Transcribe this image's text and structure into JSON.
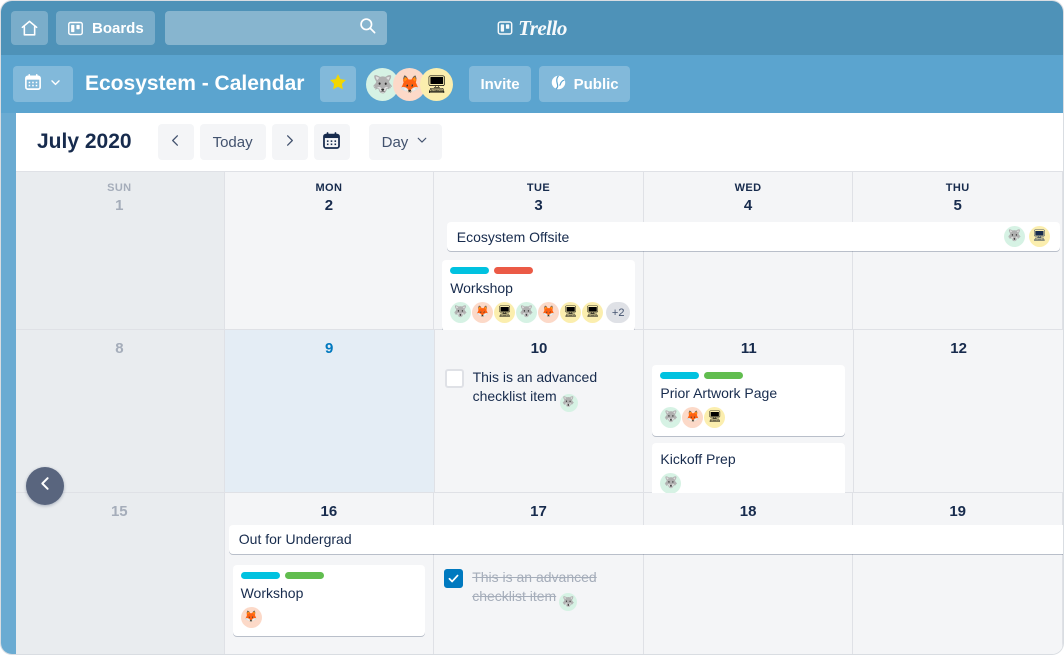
{
  "topnav": {
    "home_label": "Home",
    "boards_label": "Boards",
    "search_placeholder": "",
    "search_value": "",
    "brand_label": "Trello"
  },
  "boardbar": {
    "board_menu_label": "",
    "title": "Ecosystem - Calendar",
    "star_label": "Star board",
    "members": [
      {
        "name": "husky",
        "glyph": "🐺",
        "class": "av-husky"
      },
      {
        "name": "fox",
        "glyph": "🦊",
        "class": "av-fox"
      },
      {
        "name": "computer",
        "glyph": "🖥",
        "class": "av-comp"
      }
    ],
    "invite_label": "Invite",
    "visibility_label": "Public"
  },
  "toolbar": {
    "month_label": "July 2020",
    "prev_label": "‹",
    "today_label": "Today",
    "next_label": "›",
    "datepicker_label": "Pick a date",
    "view_label": "Day"
  },
  "colors": {
    "topnav": "#4e92b8",
    "boardbar": "#5ba4cf",
    "accent": "#0079bf",
    "label_blue": "#00c2e0",
    "label_red": "#eb5a46",
    "label_green": "#61bd4f",
    "text": "#172b4d",
    "muted": "#a5adba"
  },
  "calendar": {
    "weeks": [
      {
        "days": [
          {
            "dow": "SUN",
            "num": "1",
            "weekend": true,
            "today": false
          },
          {
            "dow": "MON",
            "num": "2",
            "weekend": false,
            "today": false
          },
          {
            "dow": "TUE",
            "num": "3",
            "weekend": false,
            "today": false
          },
          {
            "dow": "WED",
            "num": "4",
            "weekend": false,
            "today": false
          },
          {
            "dow": "THU",
            "num": "5",
            "weekend": false,
            "today": false
          }
        ]
      },
      {
        "days": [
          {
            "dow": "",
            "num": "8",
            "weekend": true,
            "today": false
          },
          {
            "dow": "",
            "num": "9",
            "weekend": false,
            "today": true
          },
          {
            "dow": "",
            "num": "10",
            "weekend": false,
            "today": false
          },
          {
            "dow": "",
            "num": "11",
            "weekend": false,
            "today": false
          },
          {
            "dow": "",
            "num": "12",
            "weekend": false,
            "today": false
          }
        ]
      },
      {
        "days": [
          {
            "dow": "",
            "num": "15",
            "weekend": true,
            "today": false
          },
          {
            "dow": "",
            "num": "16",
            "weekend": false,
            "today": false
          },
          {
            "dow": "",
            "num": "17",
            "weekend": false,
            "today": false
          },
          {
            "dow": "",
            "num": "18",
            "weekend": false,
            "today": false
          },
          {
            "dow": "",
            "num": "19",
            "weekend": false,
            "today": false
          }
        ]
      }
    ],
    "spanbars": [
      {
        "title": "Ecosystem Offsite",
        "members": [
          {
            "name": "husky",
            "glyph": "🐺",
            "class": "av-husky"
          },
          {
            "name": "computer",
            "glyph": "🖥",
            "class": "av-comp"
          }
        ]
      },
      {
        "title": "Out for Undergrad",
        "members": []
      }
    ],
    "cards": {
      "workshop_tue3": {
        "title": "Workshop",
        "labels": [
          "lb-blue",
          "lb-red"
        ],
        "members": [
          {
            "name": "husky",
            "glyph": "🐺",
            "class": "av-husky"
          },
          {
            "name": "fox",
            "glyph": "🦊",
            "class": "av-fox"
          },
          {
            "name": "computer",
            "glyph": "🖥",
            "class": "av-comp"
          },
          {
            "name": "husky",
            "glyph": "🐺",
            "class": "av-husky"
          },
          {
            "name": "fox",
            "glyph": "🦊",
            "class": "av-fox"
          },
          {
            "name": "computer",
            "glyph": "🖥",
            "class": "av-comp"
          },
          {
            "name": "computer",
            "glyph": "🖥",
            "class": "av-comp"
          }
        ],
        "overflow": "+2"
      },
      "prior_artwork_wed11": {
        "title": "Prior Artwork Page",
        "labels": [
          "lb-blue",
          "lb-green"
        ],
        "members": [
          {
            "name": "husky",
            "glyph": "🐺",
            "class": "av-husky"
          },
          {
            "name": "fox",
            "glyph": "🦊",
            "class": "av-fox"
          },
          {
            "name": "computer",
            "glyph": "🖥",
            "class": "av-comp"
          }
        ],
        "overflow": ""
      },
      "kickoff_prep_wed11": {
        "title": "Kickoff Prep",
        "labels": [],
        "members": [
          {
            "name": "husky",
            "glyph": "🐺",
            "class": "av-husky"
          }
        ],
        "overflow": ""
      },
      "workshop_mon16": {
        "title": "Workshop",
        "labels": [
          "lb-blue",
          "lb-green"
        ],
        "members": [
          {
            "name": "fox",
            "glyph": "🦊",
            "class": "av-fox"
          }
        ],
        "overflow": ""
      }
    },
    "checklist_items": {
      "tue10": {
        "text": "This is an advanced checklist item",
        "checked": false,
        "member_glyph": "🐺"
      },
      "tue17": {
        "text": "This is an advanced checklist item",
        "checked": true,
        "member_glyph": "🐺"
      }
    }
  },
  "sidebar": {
    "toggle_label": "Collapse sidebar"
  }
}
